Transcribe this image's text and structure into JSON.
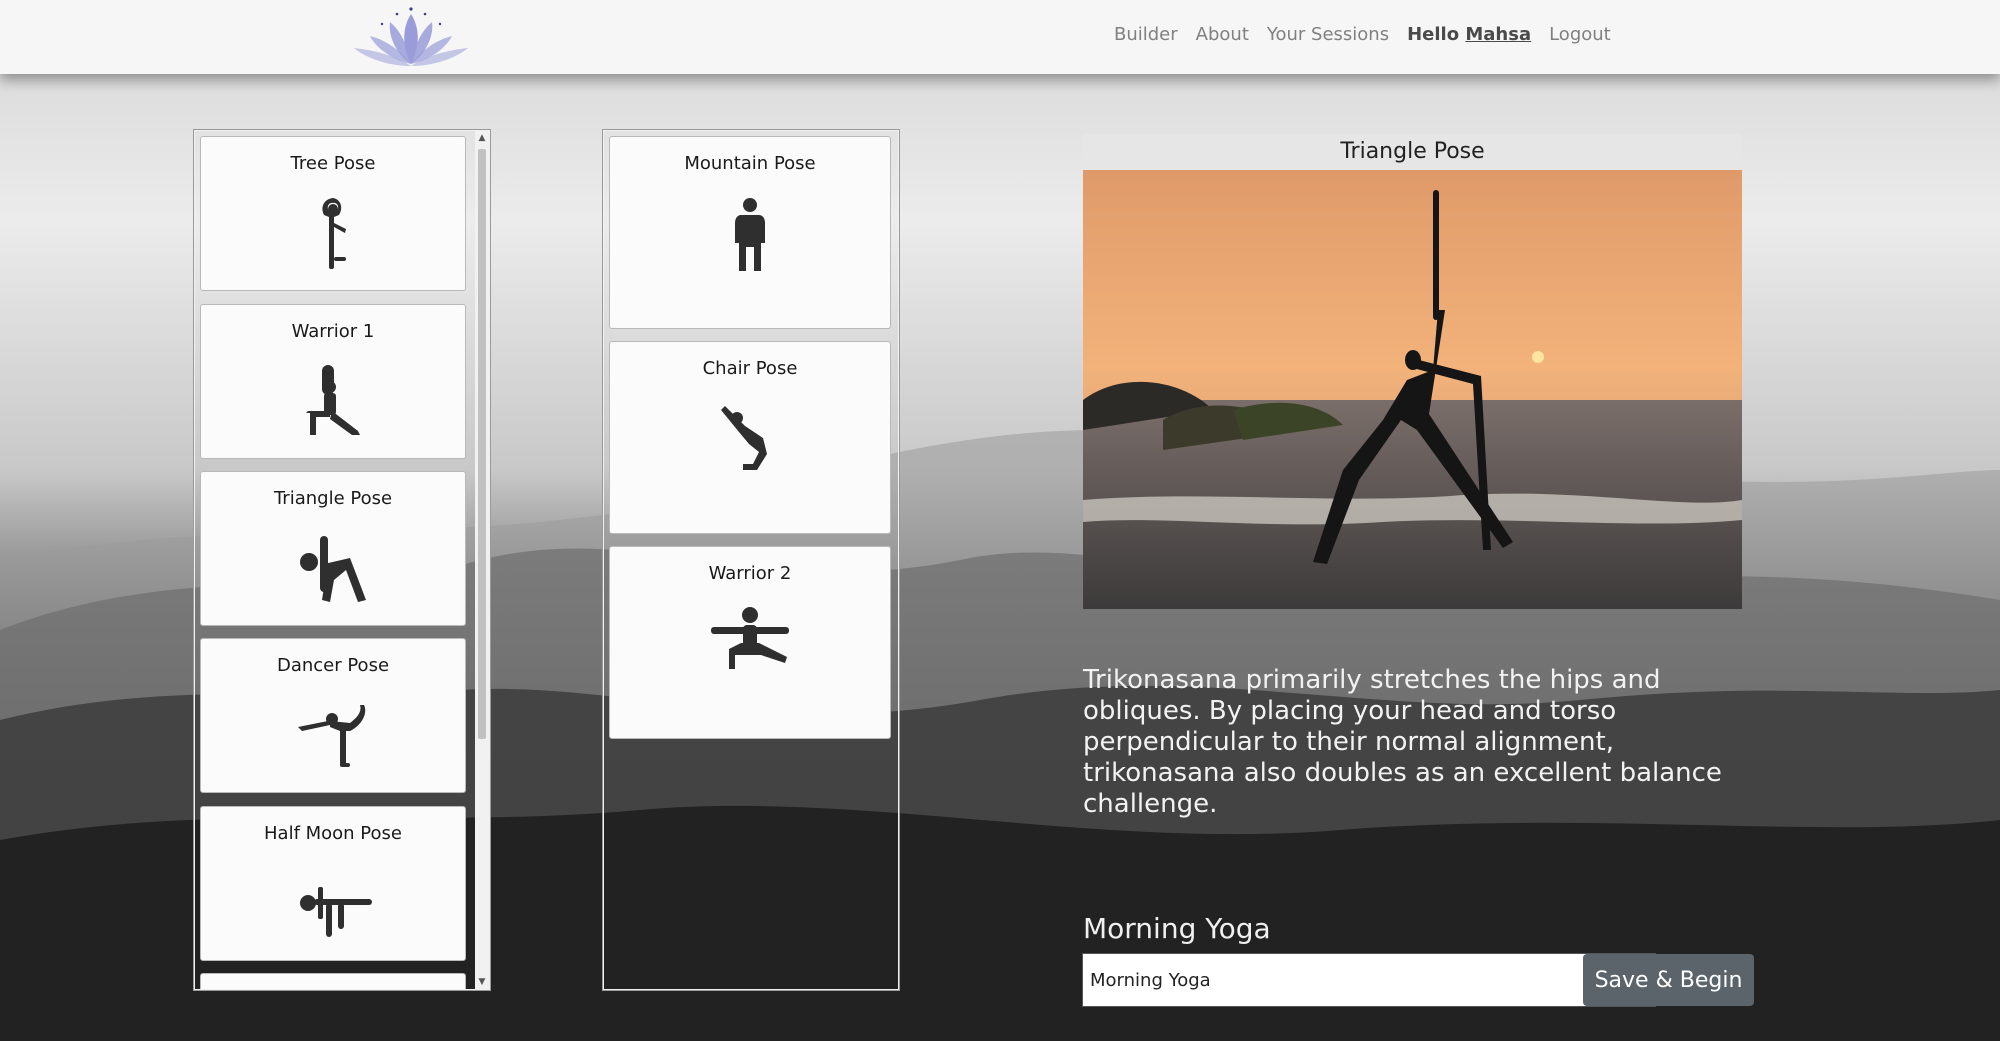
{
  "nav": {
    "items": [
      "Builder",
      "About",
      "Your Sessions"
    ],
    "hello_prefix": "Hello",
    "username": "Mahsa",
    "logout": "Logout"
  },
  "pose_library": [
    {
      "name": "Tree Pose",
      "icon": "tree-pose-icon"
    },
    {
      "name": "Warrior 1",
      "icon": "warrior-1-icon"
    },
    {
      "name": "Triangle Pose",
      "icon": "triangle-pose-icon"
    },
    {
      "name": "Dancer Pose",
      "icon": "dancer-pose-icon"
    },
    {
      "name": "Half Moon Pose",
      "icon": "half-moon-pose-icon"
    }
  ],
  "session_poses": [
    {
      "name": "Mountain Pose",
      "icon": "mountain-pose-icon"
    },
    {
      "name": "Chair Pose",
      "icon": "chair-pose-icon"
    },
    {
      "name": "Warrior 2",
      "icon": "warrior-2-icon"
    }
  ],
  "detail": {
    "title": "Triangle Pose",
    "description": "Trikonasana primarily stretches the hips and obliques. By placing your head and torso perpendicular to their normal alignment, trikonasana also doubles as an excellent balance challenge."
  },
  "session": {
    "label": "Morning Yoga",
    "name_value": "Morning Yoga",
    "save_button": "Save & Begin"
  },
  "colors": {
    "accent_button": "#5b646b",
    "logo_lotus": "#8f93d6"
  }
}
